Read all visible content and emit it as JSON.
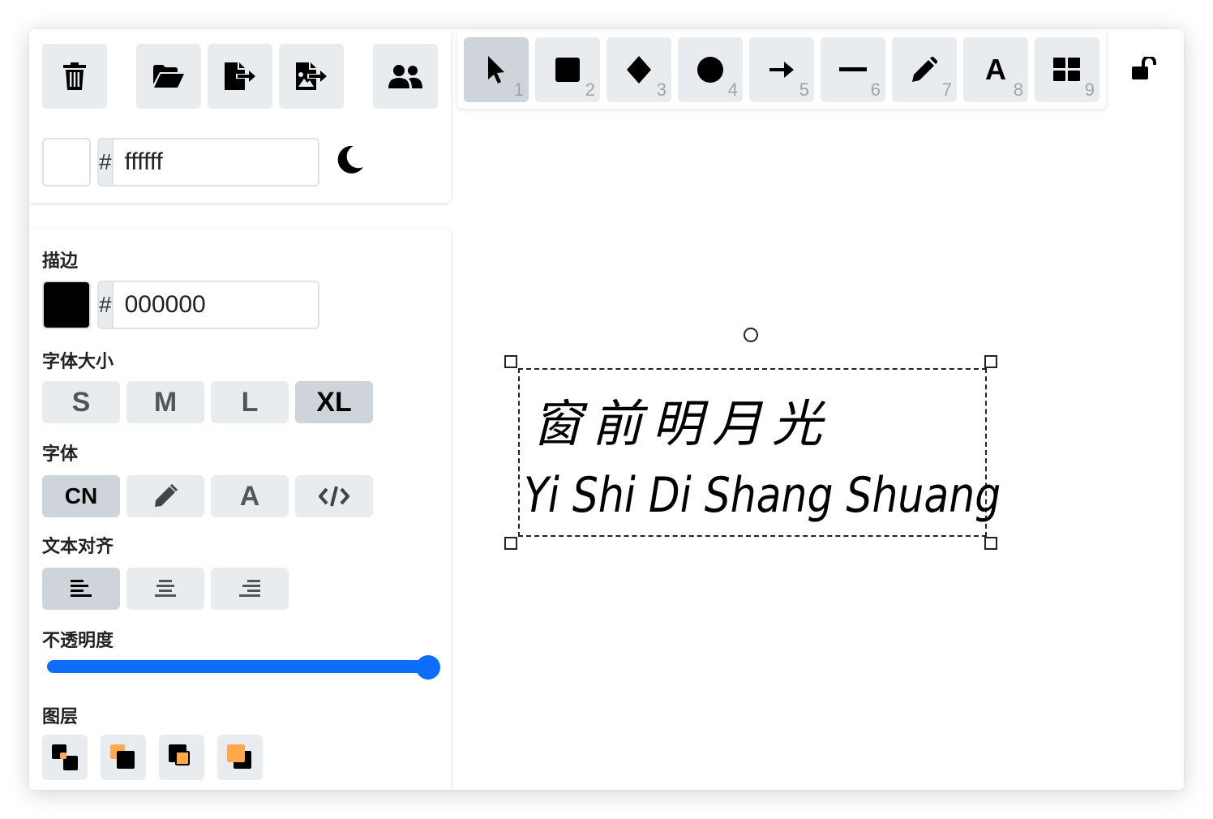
{
  "top_panel": {
    "background_hex": "ffffff",
    "hex_prefix": "#"
  },
  "toolbar": {
    "tools": [
      {
        "name": "select",
        "num": "1"
      },
      {
        "name": "rectangle",
        "num": "2"
      },
      {
        "name": "diamond",
        "num": "3"
      },
      {
        "name": "ellipse",
        "num": "4"
      },
      {
        "name": "arrow",
        "num": "5"
      },
      {
        "name": "line",
        "num": "6"
      },
      {
        "name": "draw",
        "num": "7"
      },
      {
        "name": "text",
        "num": "8"
      },
      {
        "name": "library",
        "num": "9"
      }
    ],
    "text_tool_glyph": "A"
  },
  "props": {
    "stroke_label": "描边",
    "stroke_hex": "000000",
    "hex_prefix": "#",
    "font_size_label": "字体大小",
    "font_sizes": [
      "S",
      "M",
      "L",
      "XL"
    ],
    "font_family_label": "字体",
    "font_family_cn": "CN",
    "font_family_normal": "A",
    "text_align_label": "文本对齐",
    "opacity_label": "不透明度",
    "opacity_value": 1.0,
    "layers_label": "图层"
  },
  "canvas": {
    "text_line1": "窗前明月光",
    "text_line2": "Yi Shi Di Shang Shuang"
  },
  "colors": {
    "accent": "#0d6efd",
    "button_bg": "#e9ecef",
    "button_active": "#ced4da",
    "layer_orange": "#ffa94d"
  }
}
